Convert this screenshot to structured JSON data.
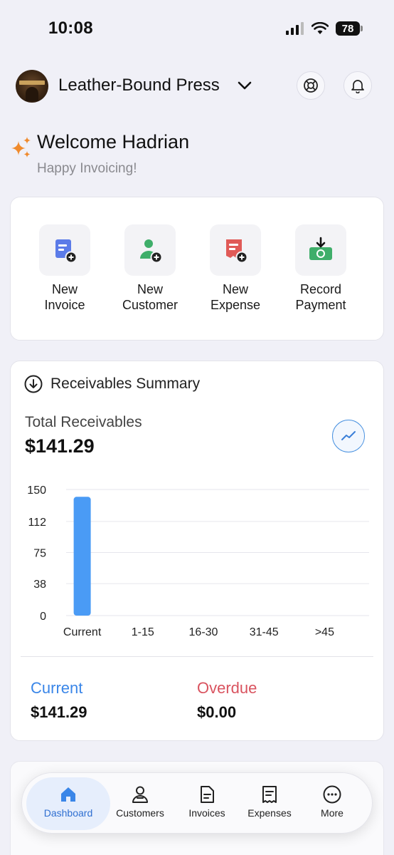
{
  "status_bar": {
    "time": "10:08",
    "battery": "78"
  },
  "header": {
    "org_name": "Leather-Bound Press"
  },
  "welcome": {
    "title": "Welcome Hadrian",
    "subtitle": "Happy Invoicing!"
  },
  "quick_actions": [
    {
      "label": "New\nInvoice",
      "icon": "invoice-add-icon",
      "color": "#5b7be8"
    },
    {
      "label": "New\nCustomer",
      "icon": "customer-add-icon",
      "color": "#3fae6a"
    },
    {
      "label": "New\nExpense",
      "icon": "expense-add-icon",
      "color": "#e05a57"
    },
    {
      "label": "Record\nPayment",
      "icon": "payment-record-icon",
      "color": "#3fae6a"
    }
  ],
  "receivables": {
    "title": "Receivables Summary",
    "total_label": "Total Receivables",
    "total_value": "$141.29",
    "current_label": "Current",
    "current_value": "$141.29",
    "overdue_label": "Overdue",
    "overdue_value": "$0.00",
    "current_color": "#3a86e8",
    "overdue_color": "#d9535f"
  },
  "chart_data": {
    "type": "bar",
    "categories": [
      "Current",
      "1-15",
      "16-30",
      "31-45",
      ">45"
    ],
    "values": [
      141.29,
      0,
      0,
      0,
      0
    ],
    "ylim": [
      0,
      150
    ],
    "yticks": [
      "150",
      "112",
      "75",
      "38",
      "0"
    ],
    "grid": true,
    "bar_color": "#4a9bf5"
  },
  "tabs": [
    {
      "label": "Dashboard",
      "icon": "home-icon",
      "active": true
    },
    {
      "label": "Customers",
      "icon": "person-icon",
      "active": false
    },
    {
      "label": "Invoices",
      "icon": "document-icon",
      "active": false
    },
    {
      "label": "Expenses",
      "icon": "receipt-icon",
      "active": false
    },
    {
      "label": "More",
      "icon": "more-icon",
      "active": false
    }
  ]
}
